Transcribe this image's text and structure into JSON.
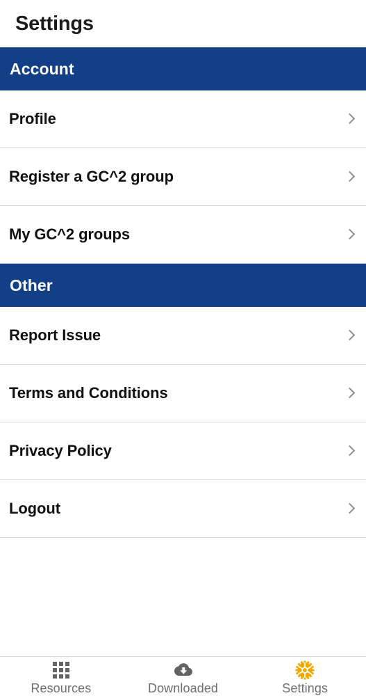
{
  "header": {
    "title": "Settings"
  },
  "colors": {
    "section_header_bg": "#123f85",
    "section_header_text": "#ffffff",
    "row_text": "#111111",
    "chevron": "#8d8d8d",
    "divider": "#d8d8d8",
    "tab_inactive": "#636363",
    "tab_label": "#6e6e6e",
    "tab_active_icon": "#f0a800"
  },
  "sections": [
    {
      "title": "Account",
      "items": [
        {
          "label": "Profile",
          "chevron": "chevron-right-icon"
        },
        {
          "label": "Register a GC^2 group",
          "chevron": "chevron-right-icon"
        },
        {
          "label": "My GC^2 groups",
          "chevron": "chevron-right-icon"
        }
      ]
    },
    {
      "title": "Other",
      "items": [
        {
          "label": "Report Issue",
          "chevron": "chevron-right-icon"
        },
        {
          "label": "Terms and Conditions",
          "chevron": "chevron-right-icon"
        },
        {
          "label": "Privacy Policy",
          "chevron": "chevron-right-icon"
        },
        {
          "label": "Logout",
          "chevron": "chevron-right-icon"
        }
      ]
    }
  ],
  "tabbar": {
    "tabs": [
      {
        "label": "Resources",
        "icon": "grid-icon",
        "active": false
      },
      {
        "label": "Downloaded",
        "icon": "cloud-download-icon",
        "active": false
      },
      {
        "label": "Settings",
        "icon": "gear-icon",
        "active": true
      }
    ]
  }
}
